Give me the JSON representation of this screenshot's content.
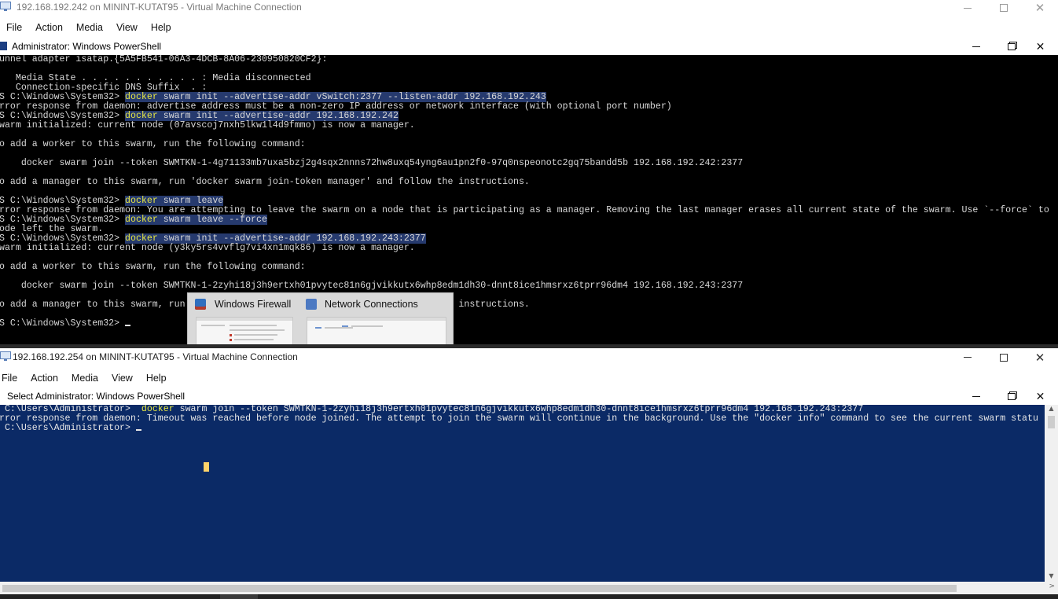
{
  "vm_top": {
    "title": "192.168.192.242 on MININT-KUTAT95 - Virtual Machine Connection",
    "menu": [
      "File",
      "Action",
      "Media",
      "View",
      "Help"
    ],
    "powershell": {
      "title": "Administrator: Windows PowerShell",
      "lines": [
        [
          {
            "t": "unnel adapter isatap.{5A5FB541-06A3-4DCB-8A06-230950820CF2}:"
          }
        ],
        [
          {
            "t": ""
          }
        ],
        [
          {
            "t": "   Media State . . . . . . . . . . . : Media disconnected"
          }
        ],
        [
          {
            "t": "   Connection-specific DNS Suffix  . :"
          }
        ],
        [
          {
            "t": "S C:\\Windows\\System32> "
          },
          {
            "t": "docker",
            "c": "cmd sel"
          },
          {
            "t": " swarm init --advertise-addr vSwitch:2377 --listen-addr 192.168.192.243",
            "c": "sel"
          }
        ],
        [
          {
            "t": "rror response from daemon: advertise address must be a non-zero IP address or network interface (with optional port number)"
          }
        ],
        [
          {
            "t": "S C:\\Windows\\System32> "
          },
          {
            "t": "docker",
            "c": "cmd sel"
          },
          {
            "t": " swarm init --advertise-addr 192.168.192.242",
            "c": "sel"
          }
        ],
        [
          {
            "t": "warm initialized: current node (07avscoj7nxh5lkw1l4d9fmmo) is now a manager."
          }
        ],
        [
          {
            "t": ""
          }
        ],
        [
          {
            "t": "o add a worker to this swarm, run the following command:"
          }
        ],
        [
          {
            "t": ""
          }
        ],
        [
          {
            "t": "    docker swarm join --token SWMTKN-1-4g71133mb7uxa5bzj2g4sqx2nnns72hw8uxq54yng6au1pn2f0-97q0nspeonotc2gq75bandd5b 192.168.192.242:2377"
          }
        ],
        [
          {
            "t": ""
          }
        ],
        [
          {
            "t": "o add a manager to this swarm, run 'docker swarm join-token manager' and follow the instructions."
          }
        ],
        [
          {
            "t": ""
          }
        ],
        [
          {
            "t": "S C:\\Windows\\System32> "
          },
          {
            "t": "docker",
            "c": "cmd sel"
          },
          {
            "t": " swarm leave",
            "c": "sel"
          }
        ],
        [
          {
            "t": "rror response from daemon: You are attempting to leave the swarm on a node that is participating as a manager. Removing the last manager erases all current state of the swarm. Use `--force` to"
          }
        ],
        [
          {
            "t": "S C:\\Windows\\System32> "
          },
          {
            "t": "docker",
            "c": "cmd sel"
          },
          {
            "t": " swarm leave --force",
            "c": "sel"
          }
        ],
        [
          {
            "t": "ode left the swarm."
          }
        ],
        [
          {
            "t": "S C:\\Windows\\System32> "
          },
          {
            "t": "docker",
            "c": "cmd sel"
          },
          {
            "t": " swarm init --advertise-addr 192.168.192.243:2377",
            "c": "sel"
          }
        ],
        [
          {
            "t": "warm initialized: current node (y3ky5rs4vvflg7vi4xn1mqk86) is now a manager."
          }
        ],
        [
          {
            "t": ""
          }
        ],
        [
          {
            "t": "o add a worker to this swarm, run the following command:"
          }
        ],
        [
          {
            "t": ""
          }
        ],
        [
          {
            "t": "    docker swarm join --token SWMTKN-1-2zyhi18j3h9ertxh01pvytec81n6gjvikkutx6whp8edm1dh30-dnnt8ice1hmsrxz6tprr96dm4 192.168.192.243:2377"
          }
        ],
        [
          {
            "t": ""
          }
        ],
        [
          {
            "t": "o add a manager to this swarm, run 'docker swarm join-token manager' and follow the instructions."
          }
        ],
        [
          {
            "t": ""
          }
        ],
        [
          {
            "t": "S C:\\Windows\\System32> "
          }
        ]
      ]
    }
  },
  "vm_bottom": {
    "title": "192.168.192.254 on MININT-KUTAT95 - Virtual Machine Connection",
    "menu": [
      "File",
      "Action",
      "Media",
      "View",
      "Help"
    ],
    "powershell": {
      "title": "Select Administrator: Windows PowerShell",
      "lines": [
        [
          {
            "t": " C:\\Users\\Administrator>  "
          },
          {
            "t": "docker",
            "c": "cmd"
          },
          {
            "t": " swarm join --token SWMTKN-1-2zyhi18j3h9ertxh01pvytec81n6gjvikkutx6whp8edm1dh30-dnnt8ice1hmsrxz6tprr96dm4 192.168.192.243:2377"
          }
        ],
        [
          {
            "t": "rror response from daemon: Timeout was reached before node joined. The attempt to join the swarm will continue in the background. Use the \"docker info\" command to see the current swarm statu"
          }
        ],
        [
          {
            "t": " C:\\Users\\Administrator> "
          }
        ]
      ]
    }
  },
  "taskbar_thumbnails": {
    "items": [
      {
        "label": "Windows Firewall",
        "icon": "firewall-icon"
      },
      {
        "label": "Network Connections",
        "icon": "network-connections-icon"
      }
    ]
  },
  "icons": {
    "vm_window": "vm-connection-icon",
    "powershell": "powershell-icon",
    "scroll_up": "chevron-up-icon",
    "scroll_down": "chevron-down-icon",
    "scroll_right": "chevron-right-icon"
  },
  "colors": {
    "console_top_bg": "#000000",
    "console_bottom_bg": "#0b2a66",
    "command_yellow": "#e7e742",
    "selection": "#263a6e"
  }
}
